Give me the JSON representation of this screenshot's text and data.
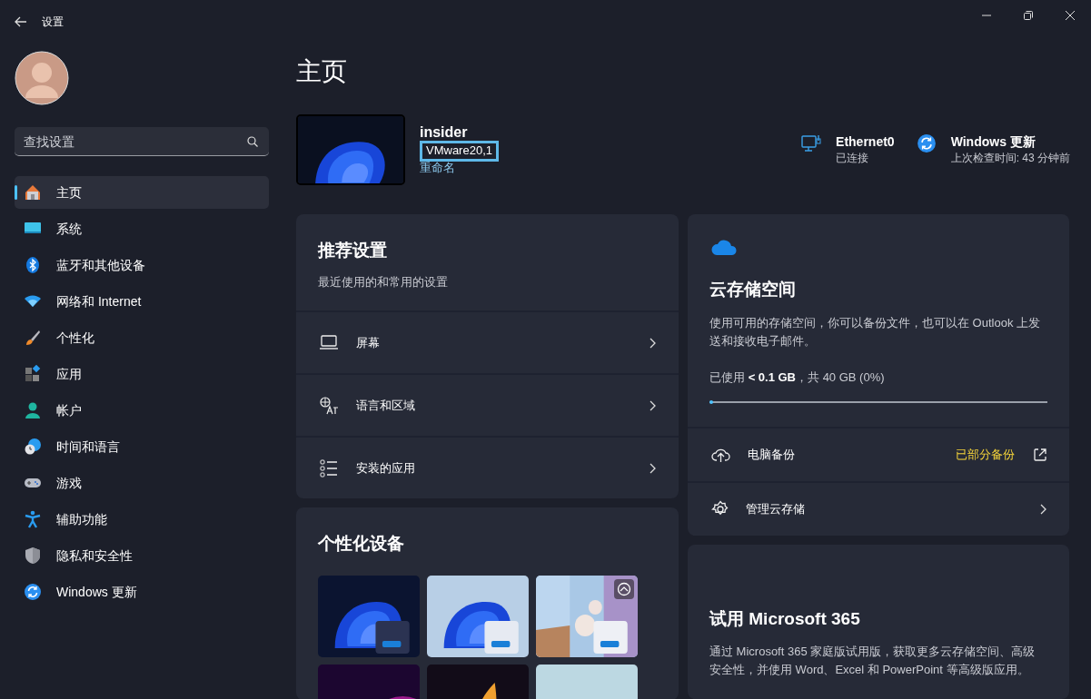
{
  "window": {
    "title": "设置"
  },
  "search": {
    "placeholder": "查找设置"
  },
  "sidebar": {
    "items": [
      {
        "label": "主页",
        "kind": "home",
        "selected": true
      },
      {
        "label": "系统",
        "kind": "system",
        "selected": false
      },
      {
        "label": "蓝牙和其他设备",
        "kind": "bluetooth",
        "selected": false
      },
      {
        "label": "网络和 Internet",
        "kind": "network",
        "selected": false
      },
      {
        "label": "个性化",
        "kind": "brush",
        "selected": false
      },
      {
        "label": "应用",
        "kind": "apps",
        "selected": false
      },
      {
        "label": "帐户",
        "kind": "account",
        "selected": false
      },
      {
        "label": "时间和语言",
        "kind": "time",
        "selected": false
      },
      {
        "label": "游戏",
        "kind": "gaming",
        "selected": false
      },
      {
        "label": "辅助功能",
        "kind": "accessibility",
        "selected": false
      },
      {
        "label": "隐私和安全性",
        "kind": "shield",
        "selected": false
      },
      {
        "label": "Windows 更新",
        "kind": "update",
        "selected": false
      }
    ]
  },
  "page_title": "主页",
  "device": {
    "name": "insider",
    "model": "VMware20,1",
    "rename": "重命名"
  },
  "status": [
    {
      "kind": "network",
      "title": "Ethernet0",
      "subtitle": "已连接"
    },
    {
      "kind": "update",
      "title": "Windows 更新",
      "subtitle": "上次检查时间: 43 分钟前"
    }
  ],
  "recommended": {
    "title": "推荐设置",
    "subtitle": "最近使用的和常用的设置",
    "items": [
      {
        "kind": "display",
        "label": "屏幕"
      },
      {
        "kind": "language",
        "label": "语言和区域"
      },
      {
        "kind": "apps",
        "label": "安装的应用"
      }
    ]
  },
  "personalize": {
    "title": "个性化设备",
    "themes": [
      {
        "kind": "picture",
        "slideshow": false
      },
      {
        "kind": "picture",
        "slideshow": false
      },
      {
        "kind": "picture",
        "slideshow": true
      },
      {
        "kind": "picture"
      },
      {
        "kind": "picture"
      },
      {
        "kind": "picture"
      }
    ]
  },
  "cloud": {
    "title": "云存储空间",
    "description": "使用可用的存储空间，你可以备份文件，也可以在 Outlook 上发送和接收电子邮件。",
    "usage": "已使用 **< 0.1 GB**，共 40 GB (0%)",
    "level": 0.004,
    "rows": [
      {
        "kind": "backup",
        "label": "电脑备份",
        "status": "已部分备份"
      },
      {
        "kind": "manage",
        "label": "管理云存储"
      }
    ]
  },
  "m365": {
    "title": "试用 Microsoft 365",
    "description": "通过 Microsoft 365 家庭版试用版，获取更多云存储空间、高级安全性，并使用 Word、Excel 和 PowerPoint 等高级版应用。"
  }
}
